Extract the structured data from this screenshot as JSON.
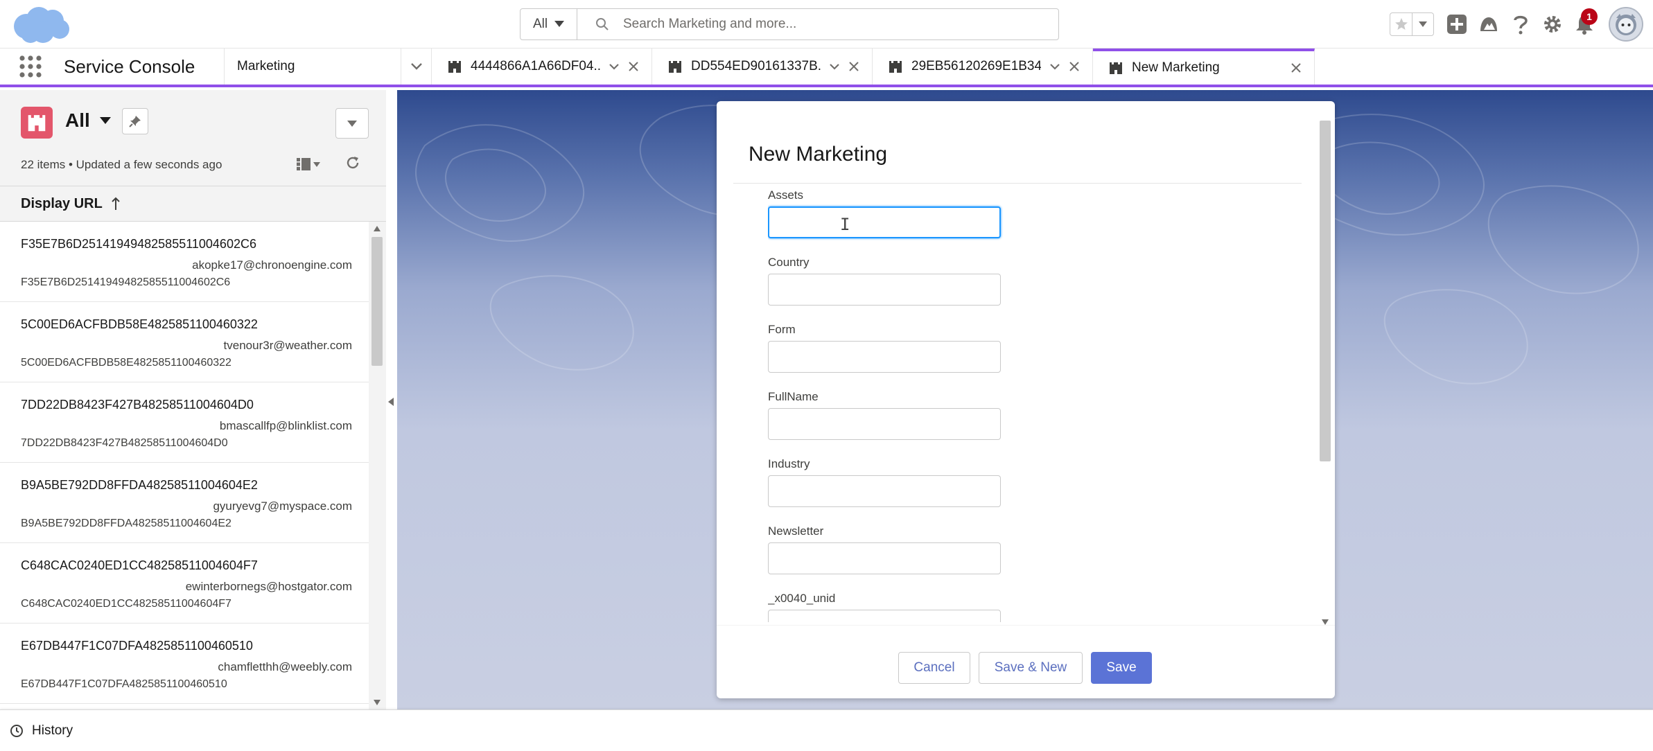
{
  "header": {
    "search_scope": "All",
    "search_placeholder": "Search Marketing and more...",
    "notification_count": "1"
  },
  "tabbar": {
    "app_name": "Service Console",
    "object_tab": "Marketing",
    "record_tabs": [
      {
        "label": "4444866A1A66DF04..."
      },
      {
        "label": "DD554ED90161337B..."
      },
      {
        "label": "29EB56120269E1B34..."
      }
    ],
    "active_tab": "New Marketing"
  },
  "list": {
    "view_name": "All",
    "meta": "22 items • Updated a few seconds ago",
    "column_header": "Display URL",
    "items": [
      {
        "title": "F35E7B6D25141949482585511004602C6",
        "email": "akopke17@chronoengine.com",
        "sub": "F35E7B6D25141949482585511004602C6"
      },
      {
        "title": "5C00ED6ACFBDB58E4825851100460322",
        "email": "tvenour3r@weather.com",
        "sub": "5C00ED6ACFBDB58E4825851100460322"
      },
      {
        "title": "7DD22DB8423F427B48258511004604D0",
        "email": "bmascallfp@blinklist.com",
        "sub": "7DD22DB8423F427B48258511004604D0"
      },
      {
        "title": "B9A5BE792DD8FFDA48258511004604E2",
        "email": "gyuryevg7@myspace.com",
        "sub": "B9A5BE792DD8FFDA48258511004604E2"
      },
      {
        "title": "C648CAC0240ED1CC48258511004604F7",
        "email": "ewinterbornegs@hostgator.com",
        "sub": "C648CAC0240ED1CC48258511004604F7"
      },
      {
        "title": "E67DB447F1C07DFA4825851100460510",
        "email": "chamfletthh@weebly.com",
        "sub": "E67DB447F1C07DFA4825851100460510"
      }
    ]
  },
  "modal": {
    "title": "New Marketing",
    "fields": [
      {
        "label": "Assets",
        "value": ""
      },
      {
        "label": "Country",
        "value": ""
      },
      {
        "label": "Form",
        "value": ""
      },
      {
        "label": "FullName",
        "value": ""
      },
      {
        "label": "Industry",
        "value": ""
      },
      {
        "label": "Newsletter",
        "value": ""
      },
      {
        "label": "_x0040_unid",
        "value": ""
      }
    ],
    "cancel_label": "Cancel",
    "save_new_label": "Save & New",
    "save_label": "Save"
  },
  "utility": {
    "history_label": "History"
  },
  "colors": {
    "accent_purple": "#9050e9",
    "brand_button": "#5b73d6",
    "object_icon": "#e3566b",
    "focus_blue": "#1b96ff"
  }
}
